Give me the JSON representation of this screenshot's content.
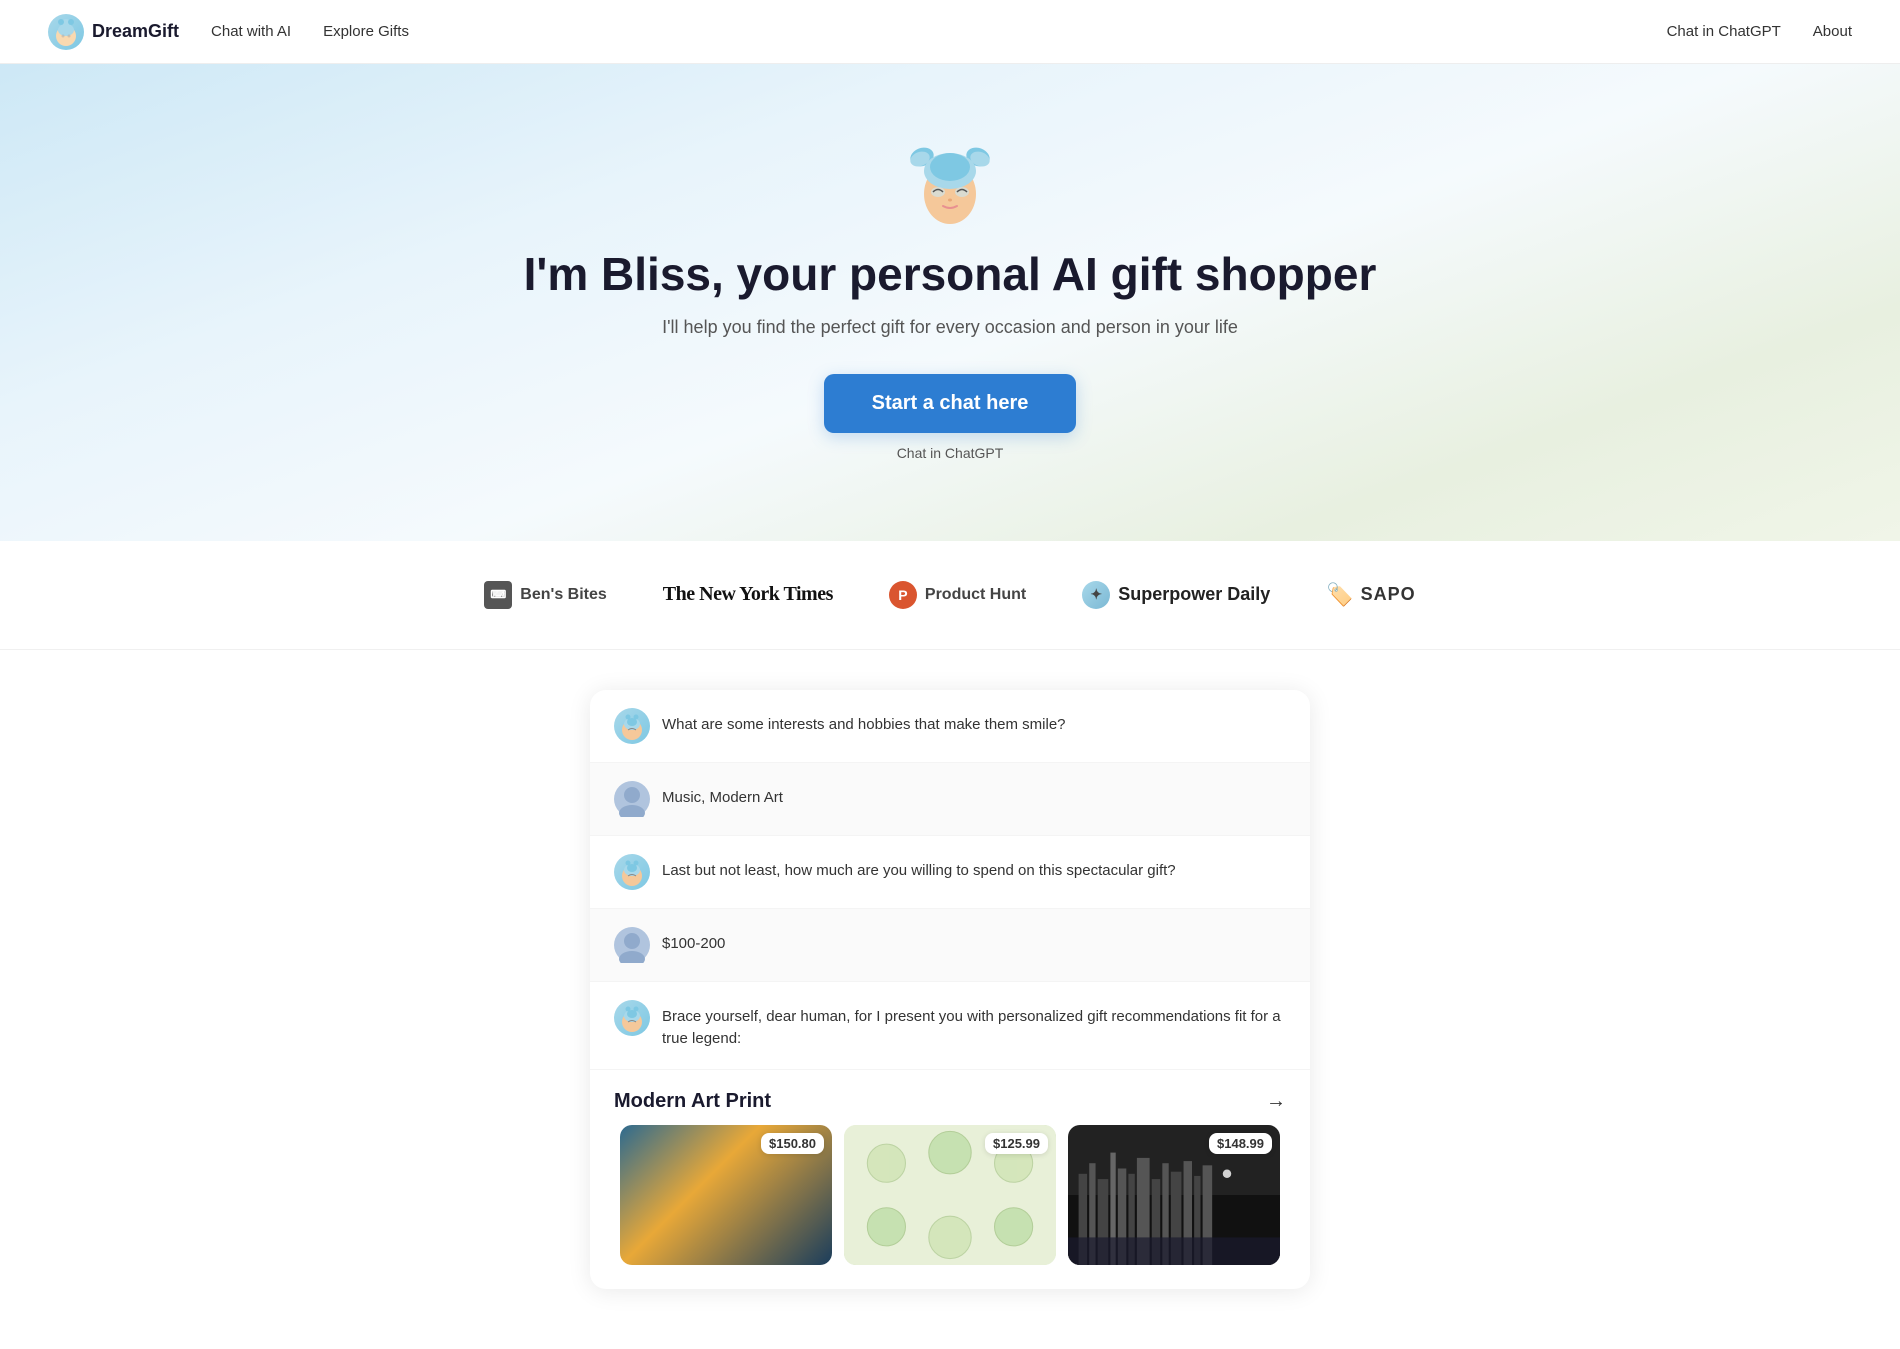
{
  "nav": {
    "logo_text": "DreamGift",
    "links_left": [
      "Chat with AI",
      "Explore Gifts"
    ],
    "links_right": [
      "Chat in ChatGPT",
      "About"
    ]
  },
  "hero": {
    "headline": "I'm Bliss, your personal AI gift shopper",
    "subheadline": "I'll help you find the perfect gift for every occasion and person in your life",
    "cta_label": "Start a chat here",
    "cta_sub": "Chat in ChatGPT"
  },
  "logos": [
    {
      "name": "Ben's Bites",
      "type": "box"
    },
    {
      "name": "The New York Times",
      "type": "nyt"
    },
    {
      "name": "Product Hunt",
      "type": "ph"
    },
    {
      "name": "Superpower Daily",
      "type": "sp"
    },
    {
      "name": "SAPO",
      "type": "sapo"
    }
  ],
  "chat": {
    "messages": [
      {
        "role": "ai",
        "text": "What are some interests and hobbies that make them smile?"
      },
      {
        "role": "user",
        "text": "Music, Modern Art"
      },
      {
        "role": "ai",
        "text": "Last but not least, how much are you willing to spend on this spectacular gift?"
      },
      {
        "role": "user",
        "text": "$100-200"
      },
      {
        "role": "ai",
        "text": "Brace yourself, dear human, for I present you with personalized gift recommendations fit for a true legend:"
      }
    ]
  },
  "products": {
    "category": "Modern Art Print",
    "items": [
      {
        "price": "$150.80",
        "type": "art-1"
      },
      {
        "price": "$125.99",
        "type": "art-2"
      },
      {
        "price": "$148.99",
        "type": "art-3"
      }
    ]
  }
}
